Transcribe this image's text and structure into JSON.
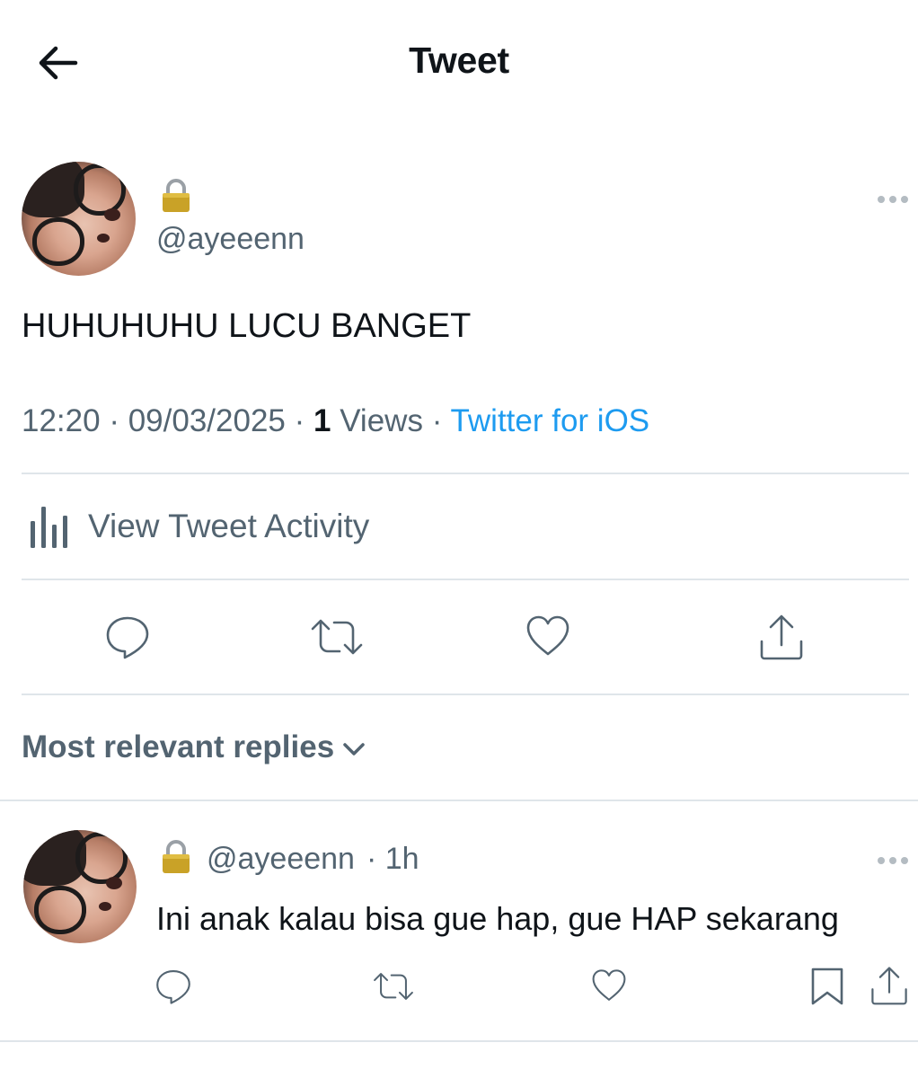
{
  "header": {
    "title": "Tweet",
    "back_icon": "arrow-left-icon"
  },
  "tweet": {
    "handle": "@ayeeenn",
    "protected_icon": "lock-icon",
    "text": "HUHUHUHU LUCU BANGET",
    "time": "12:20",
    "date": "09/03/2025",
    "view_count": "1",
    "views_label": "Views",
    "separator": "·",
    "source": "Twitter for iOS",
    "activity_label": "View Tweet Activity",
    "activity_icon": "bar-chart-icon",
    "actions": [
      "reply-icon",
      "retweet-icon",
      "like-icon",
      "share-icon"
    ]
  },
  "replies": {
    "sort_label": "Most relevant replies",
    "sort_icon": "chevron-down-icon",
    "items": [
      {
        "handle": "@ayeeenn",
        "time": "· 1h",
        "text": "Ini anak kalau bisa gue hap, gue HAP sekarang",
        "actions": [
          "reply-icon",
          "retweet-icon",
          "like-icon",
          "bookmark-icon",
          "share-icon"
        ]
      }
    ]
  },
  "colors": {
    "text_primary": "#0f1419",
    "text_secondary": "#536471",
    "link": "#1d9bf0",
    "divider": "#dfe5ea"
  }
}
